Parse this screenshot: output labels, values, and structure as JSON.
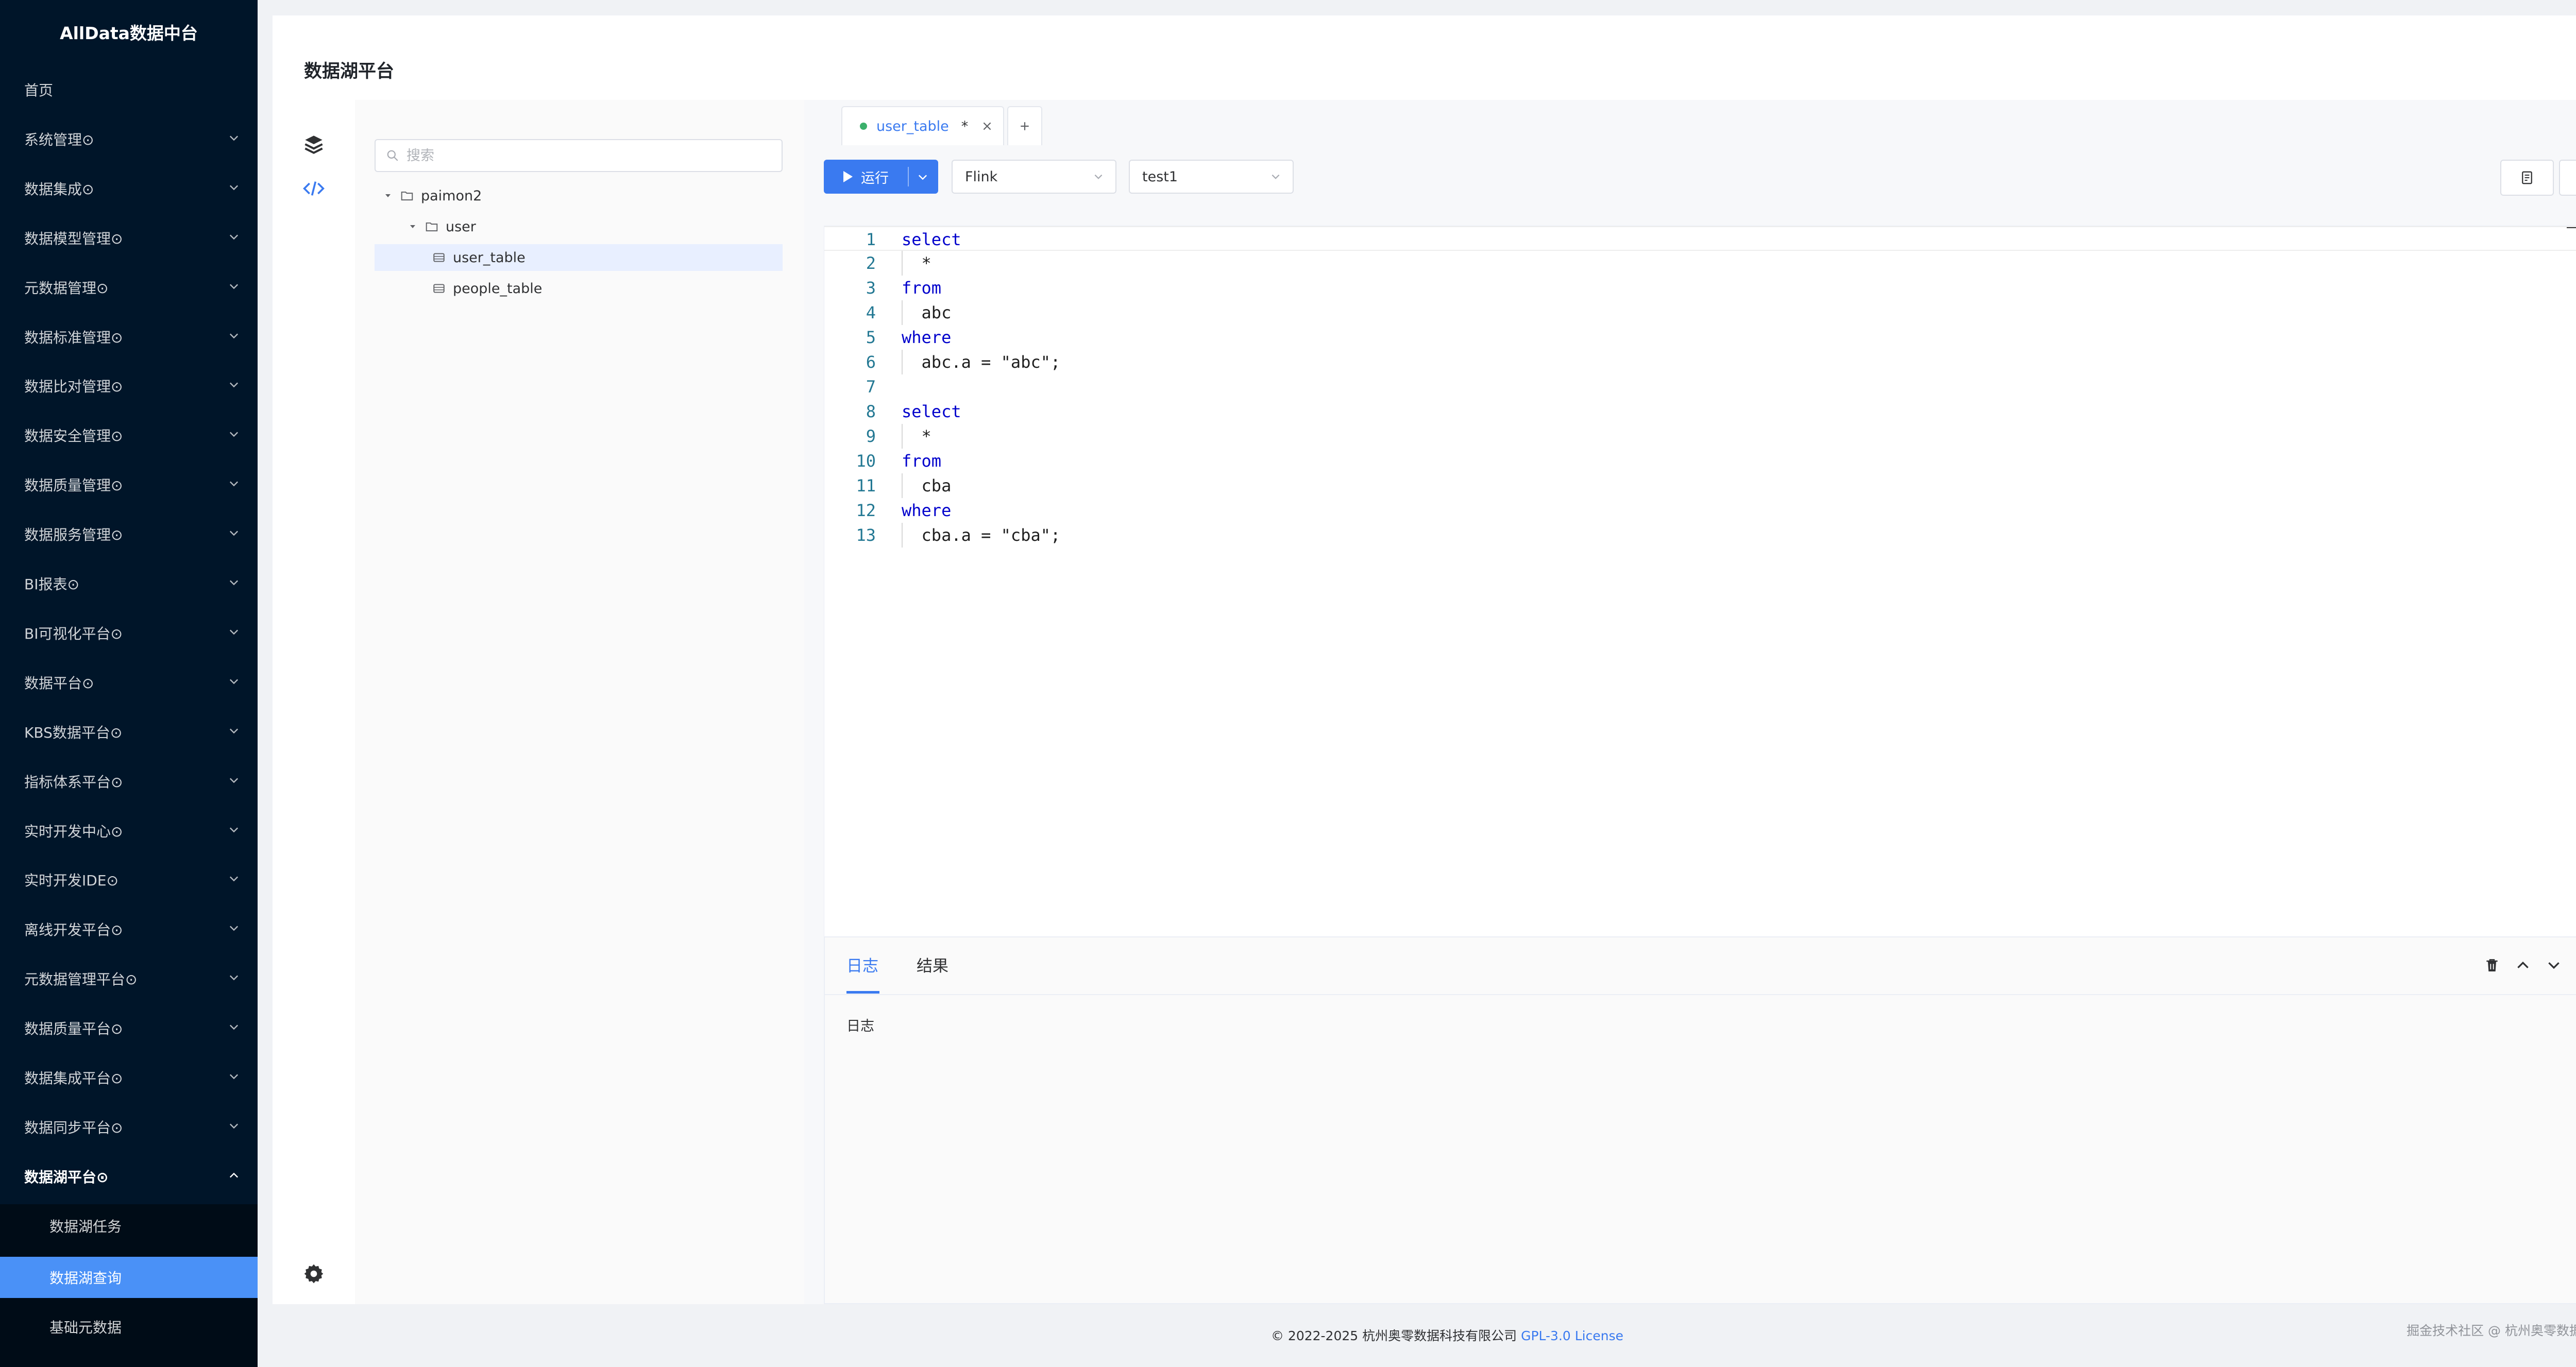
{
  "app": {
    "title": "AllData数据中台"
  },
  "sidebar": {
    "items": [
      {
        "label": "首页"
      },
      {
        "label": "系统管理⊙"
      },
      {
        "label": "数据集成⊙"
      },
      {
        "label": "数据模型管理⊙"
      },
      {
        "label": "元数据管理⊙"
      },
      {
        "label": "数据标准管理⊙"
      },
      {
        "label": "数据比对管理⊙"
      },
      {
        "label": "数据安全管理⊙"
      },
      {
        "label": "数据质量管理⊙"
      },
      {
        "label": "数据服务管理⊙"
      },
      {
        "label": "BI报表⊙"
      },
      {
        "label": "BI可视化平台⊙"
      },
      {
        "label": "数据平台⊙"
      },
      {
        "label": "KBS数据平台⊙"
      },
      {
        "label": "指标体系平台⊙"
      },
      {
        "label": "实时开发中心⊙"
      },
      {
        "label": "实时开发IDE⊙"
      },
      {
        "label": "离线开发平台⊙"
      },
      {
        "label": "元数据管理平台⊙"
      },
      {
        "label": "数据质量平台⊙"
      },
      {
        "label": "数据集成平台⊙"
      },
      {
        "label": "数据同步平台⊙"
      },
      {
        "label": "数据湖平台⊙"
      }
    ],
    "submenu": [
      {
        "label": "数据湖任务"
      },
      {
        "label": "数据湖查询"
      },
      {
        "label": "基础元数据"
      }
    ]
  },
  "page": {
    "title": "数据湖平台"
  },
  "tree": {
    "search_placeholder": "搜索",
    "nodes": [
      {
        "label": "paimon2"
      },
      {
        "label": "user"
      },
      {
        "label": "user_table"
      },
      {
        "label": "people_table"
      }
    ]
  },
  "editor": {
    "tab": {
      "label": "user_table",
      "modified_mark": "*"
    },
    "run_label": "运行",
    "engine": "Flink",
    "catalog": "test1",
    "lines": [
      {
        "no": "1",
        "parts": [
          {
            "t": "select",
            "kw": true
          }
        ]
      },
      {
        "no": "2",
        "parts": [
          {
            "t": "  *",
            "kw": false
          }
        ]
      },
      {
        "no": "3",
        "parts": [
          {
            "t": "from",
            "kw": true
          }
        ]
      },
      {
        "no": "4",
        "parts": [
          {
            "t": "  abc",
            "kw": false
          }
        ]
      },
      {
        "no": "5",
        "parts": [
          {
            "t": "where",
            "kw": true
          }
        ]
      },
      {
        "no": "6",
        "parts": [
          {
            "t": "  abc.a = \"abc\";",
            "kw": false
          }
        ]
      },
      {
        "no": "7",
        "parts": []
      },
      {
        "no": "8",
        "parts": [
          {
            "t": "select",
            "kw": true
          }
        ]
      },
      {
        "no": "9",
        "parts": [
          {
            "t": "  *",
            "kw": false
          }
        ]
      },
      {
        "no": "10",
        "parts": [
          {
            "t": "from",
            "kw": true
          }
        ]
      },
      {
        "no": "11",
        "parts": [
          {
            "t": "  cba",
            "kw": false
          }
        ]
      },
      {
        "no": "12",
        "parts": [
          {
            "t": "where",
            "kw": true
          }
        ]
      },
      {
        "no": "13",
        "parts": [
          {
            "t": "  cba.a = \"cba\";",
            "kw": false
          }
        ]
      }
    ]
  },
  "console": {
    "tabs": [
      {
        "label": "日志"
      },
      {
        "label": "结果"
      }
    ],
    "body": "日志"
  },
  "footer": {
    "copyright": "© 2022-2025 杭州奥零数据科技有限公司",
    "license": "GPL-3.0 License",
    "right": "掘金技术社区 @ 杭州奥零数据科技"
  }
}
